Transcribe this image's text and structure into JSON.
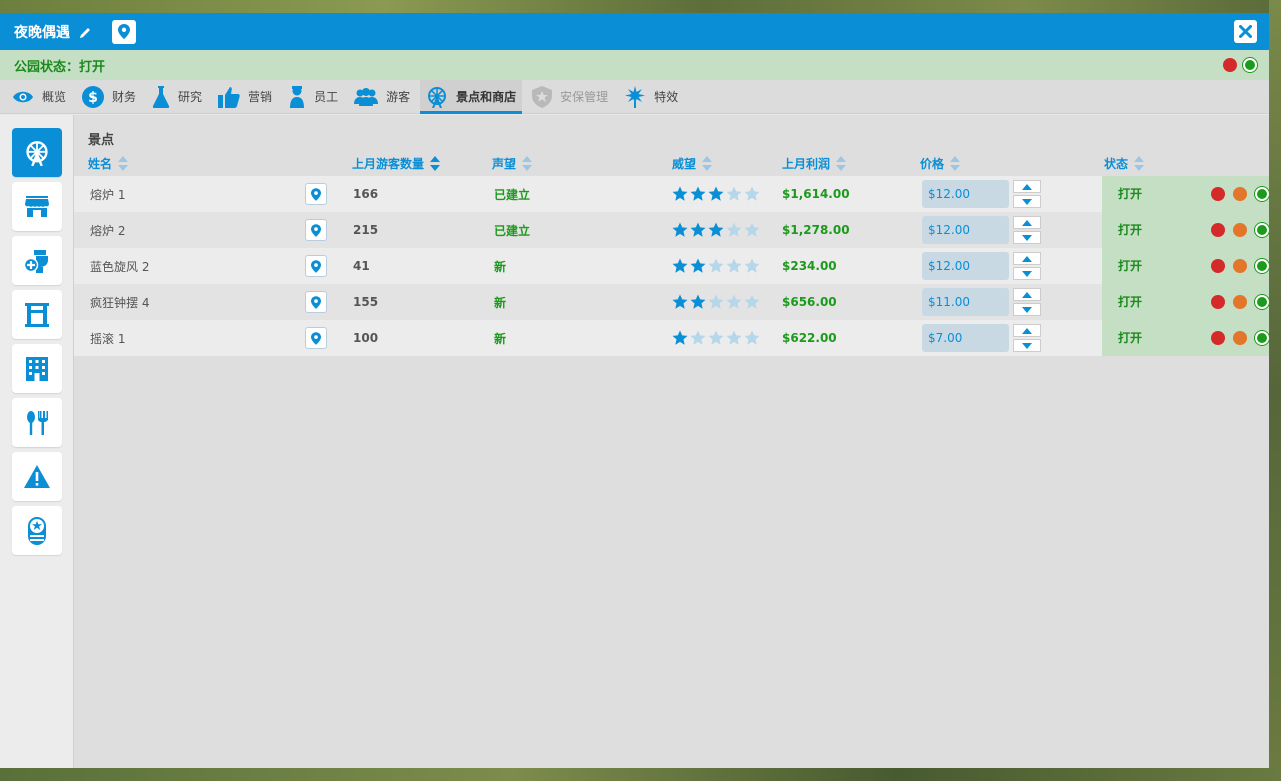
{
  "window": {
    "title": "夜晚偶遇"
  },
  "park_status": {
    "label": "公园状态：打开"
  },
  "tabs": [
    {
      "label": "概览",
      "icon": "eye-icon"
    },
    {
      "label": "财务",
      "icon": "dollar-icon"
    },
    {
      "label": "研究",
      "icon": "flask-icon"
    },
    {
      "label": "营销",
      "icon": "thumbs-up-icon"
    },
    {
      "label": "员工",
      "icon": "staff-icon"
    },
    {
      "label": "游客",
      "icon": "guests-icon"
    },
    {
      "label": "景点和商店",
      "icon": "ferris-wheel-icon",
      "active": true
    },
    {
      "label": "安保管理",
      "icon": "badge-icon",
      "disabled": true
    },
    {
      "label": "特效",
      "icon": "fireworks-icon"
    }
  ],
  "sidebar": [
    {
      "icon": "ferris-wheel-icon",
      "active": true
    },
    {
      "icon": "shop-icon"
    },
    {
      "icon": "restroom-icon"
    },
    {
      "icon": "gate-icon"
    },
    {
      "icon": "building-icon"
    },
    {
      "icon": "food-icon"
    },
    {
      "icon": "warning-icon"
    },
    {
      "icon": "security-icon"
    }
  ],
  "section": {
    "title": "景点"
  },
  "columns": {
    "name": "姓名",
    "visitors": "上月游客数量",
    "reputation": "声望",
    "prestige": "威望",
    "profit": "上月利润",
    "price": "价格",
    "status": "状态"
  },
  "rows": [
    {
      "name": "熔炉 1",
      "visitors": "166",
      "reputation": "已建立",
      "stars": 3,
      "profit": "$1,614.00",
      "price": "$12.00",
      "status": "打开"
    },
    {
      "name": "熔炉 2",
      "visitors": "215",
      "reputation": "已建立",
      "stars": 3,
      "profit": "$1,278.00",
      "price": "$12.00",
      "status": "打开"
    },
    {
      "name": "蓝色旋风 2",
      "visitors": "41",
      "reputation": "新",
      "stars": 2,
      "profit": "$234.00",
      "price": "$12.00",
      "status": "打开"
    },
    {
      "name": "疯狂钟摆 4",
      "visitors": "155",
      "reputation": "新",
      "stars": 2,
      "profit": "$656.00",
      "price": "$11.00",
      "status": "打开"
    },
    {
      "name": "摇滚 1",
      "visitors": "100",
      "reputation": "新",
      "stars": 1,
      "profit": "$622.00",
      "price": "$7.00",
      "status": "打开"
    }
  ],
  "colors": {
    "accent": "#0a8fd6",
    "good": "#1c9a1c",
    "status_bg": "#c4dfc4"
  }
}
